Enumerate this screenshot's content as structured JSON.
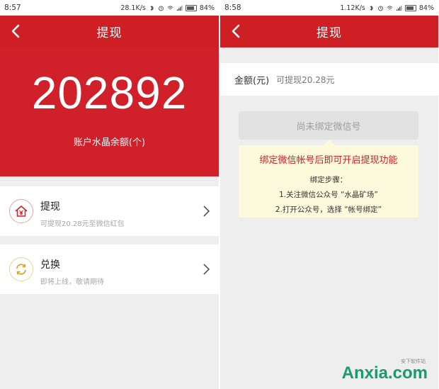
{
  "left": {
    "status": {
      "time": "8:57",
      "speed": "28.1K/s",
      "battery": "84%"
    },
    "title": "提现",
    "balance": "202892",
    "balance_label": "账户水晶余额(个)",
    "items": [
      {
        "label": "提现",
        "sub": "可提现20.28元至微信红包",
        "icon": "yen-house-icon"
      },
      {
        "label": "兑换",
        "sub": "即将上线，敬请期待",
        "icon": "exchange-refresh-icon"
      }
    ]
  },
  "right": {
    "status": {
      "time": "8:58",
      "speed": "1.12K/s",
      "battery": "84%"
    },
    "title": "提现",
    "amount_label": "金额(元)",
    "amount_hint": "可提现20.28元",
    "bind_button": "尚未绑定微信号",
    "tip": {
      "title": "绑定微信帐号后即可开启提现功能",
      "steps_title": "绑定步骤：",
      "steps": [
        "1.关注微信公众号 “水晶矿场”",
        "2.打开公众号，选择 “帐号绑定”"
      ]
    }
  },
  "watermark": {
    "text": "Anxia.com",
    "subtext": "安下软件站"
  },
  "colors": {
    "brand_red": "#ce2024",
    "hint_bg": "#fdf9dc",
    "watermark_green": "#1b9a6b"
  }
}
